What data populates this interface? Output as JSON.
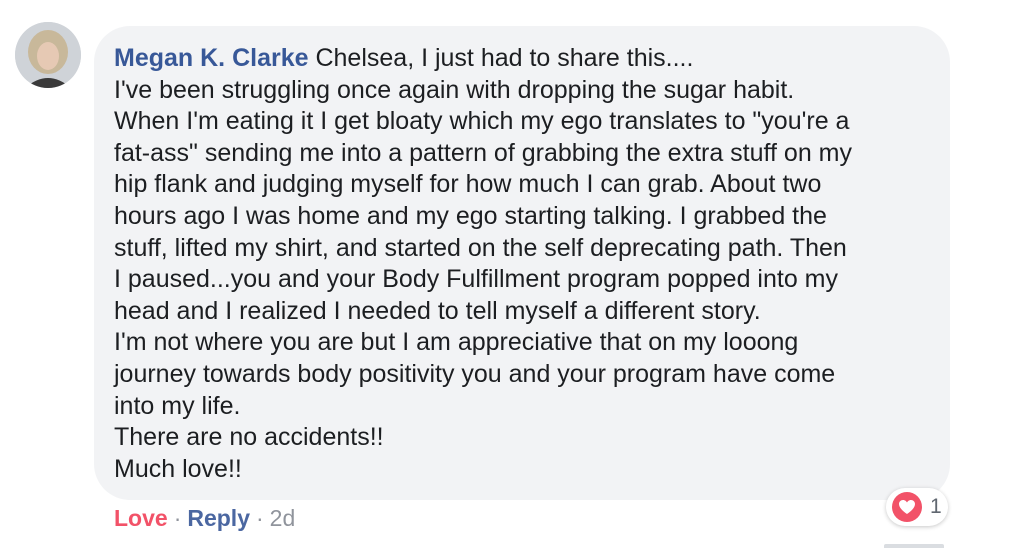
{
  "comment": {
    "author": "Megan K. Clarke",
    "lines": [
      "Chelsea, I just had to share this....",
      "I've been struggling once again with dropping the sugar habit.",
      "When I'm eating it I get bloaty which my ego translates to \"you're a",
      "fat-ass\" sending me into a pattern of grabbing the extra stuff on my",
      "hip flank and judging myself for how much I can grab. About two",
      "hours ago I was home and my ego starting talking. I grabbed the",
      "stuff, lifted my shirt, and started on the self deprecating path. Then",
      "I paused...you and your Body Fulfillment program popped into my",
      "head and I realized I needed to tell myself a different story.",
      "I'm not where you are but I am appreciative that on my looong",
      "journey towards body positivity you and your program have come",
      "into my life.",
      "There are no accidents!!",
      "Much love!!"
    ]
  },
  "reaction": {
    "icon": "heart-icon",
    "count": "1",
    "color": "#f25268"
  },
  "actions": {
    "love_label": "Love",
    "separator": "·",
    "reply_label": "Reply",
    "time": "2d"
  }
}
